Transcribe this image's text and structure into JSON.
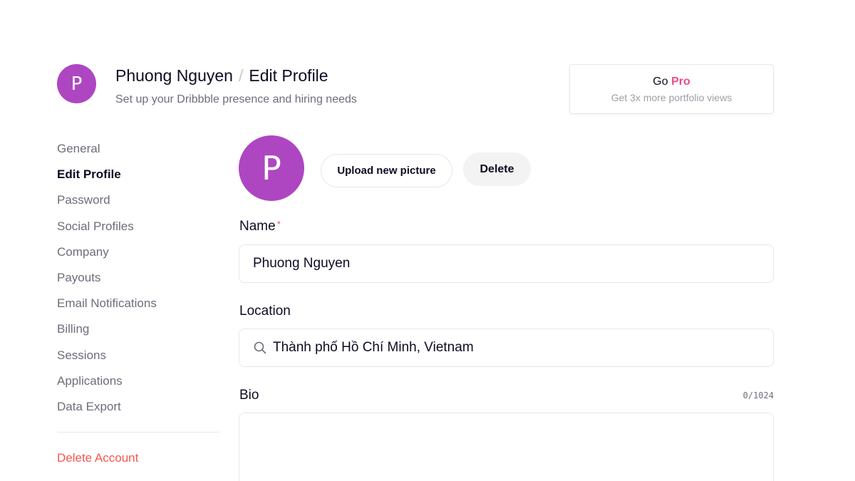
{
  "header": {
    "avatar_initial": "P",
    "user_name": "Phuong Nguyen",
    "separator": "/",
    "page_name": "Edit Profile",
    "subtitle": "Set up your Dribbble presence and hiring needs"
  },
  "go_pro": {
    "prefix": "Go",
    "highlight": "Pro",
    "subtitle": "Get 3x more portfolio views"
  },
  "sidebar": {
    "items": [
      {
        "label": "General",
        "active": false
      },
      {
        "label": "Edit Profile",
        "active": true
      },
      {
        "label": "Password",
        "active": false
      },
      {
        "label": "Social Profiles",
        "active": false
      },
      {
        "label": "Company",
        "active": false
      },
      {
        "label": "Payouts",
        "active": false
      },
      {
        "label": "Email Notifications",
        "active": false
      },
      {
        "label": "Billing",
        "active": false
      },
      {
        "label": "Sessions",
        "active": false
      },
      {
        "label": "Applications",
        "active": false
      },
      {
        "label": "Data Export",
        "active": false
      }
    ],
    "delete_account": "Delete Account"
  },
  "profile": {
    "avatar_initial": "P",
    "upload_button": "Upload new picture",
    "delete_button": "Delete"
  },
  "form": {
    "name_label": "Name",
    "name_required_mark": "*",
    "name_value": "Phuong Nguyen",
    "location_label": "Location",
    "location_value": "Thành phố Hồ Chí Minh, Vietnam",
    "bio_label": "Bio",
    "bio_counter": "0/1024",
    "bio_value": ""
  },
  "colors": {
    "avatar_bg": "#ae46c2",
    "pro_accent": "#ea4c89",
    "danger": "#f4564f",
    "text_primary": "#0d0c22",
    "text_muted": "#6e6d7a"
  }
}
